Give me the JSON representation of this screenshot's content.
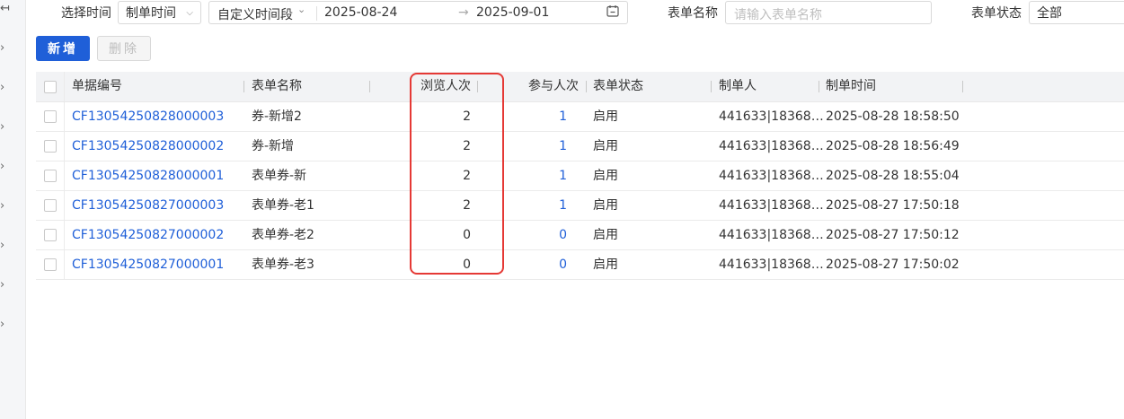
{
  "sidebar": {
    "collapse_glyph": "↤",
    "arrow_glyph": "›"
  },
  "filters": {
    "time_label": "选择时间",
    "time_type": "制单时间",
    "range_type": "自定义时间段",
    "start_date": "2025-08-24",
    "range_arrow": "→",
    "end_date": "2025-09-01",
    "form_name_label": "表单名称",
    "form_name_placeholder": "请输入表单名称",
    "status_label": "表单状态",
    "status_value": "全部"
  },
  "toolbar": {
    "add_label": "新增",
    "delete_label": "删除"
  },
  "table": {
    "columns": [
      "单据编号",
      "表单名称",
      "浏览人次",
      "参与人次",
      "表单状态",
      "制单人",
      "制单时间"
    ],
    "rows": [
      {
        "id": "CF13054250828000003",
        "name": "券-新增2",
        "views": "2",
        "participants": "1",
        "status": "启用",
        "creator": "441633|18368…",
        "time": "2025-08-28 18:58:50"
      },
      {
        "id": "CF13054250828000002",
        "name": "券-新增",
        "views": "2",
        "participants": "1",
        "status": "启用",
        "creator": "441633|18368…",
        "time": "2025-08-28 18:56:49"
      },
      {
        "id": "CF13054250828000001",
        "name": "表单券-新",
        "views": "2",
        "participants": "1",
        "status": "启用",
        "creator": "441633|18368…",
        "time": "2025-08-28 18:55:04"
      },
      {
        "id": "CF13054250827000003",
        "name": "表单券-老1",
        "views": "2",
        "participants": "1",
        "status": "启用",
        "creator": "441633|18368…",
        "time": "2025-08-27 17:50:18"
      },
      {
        "id": "CF13054250827000002",
        "name": "表单券-老2",
        "views": "0",
        "participants": "0",
        "status": "启用",
        "creator": "441633|18368…",
        "time": "2025-08-27 17:50:12"
      },
      {
        "id": "CF13054250827000001",
        "name": "表单券-老3",
        "views": "0",
        "participants": "0",
        "status": "启用",
        "creator": "441633|18368…",
        "time": "2025-08-27 17:50:02"
      }
    ]
  },
  "colors": {
    "primary": "#1f5fd8",
    "highlight": "#e53935"
  }
}
